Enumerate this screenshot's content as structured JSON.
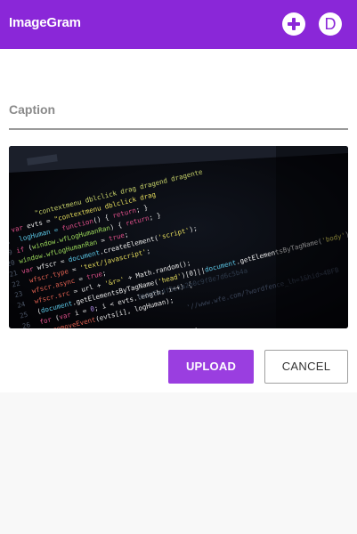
{
  "app": {
    "title": "ImageGram",
    "avatar_letter": "D",
    "brand_color": "#8a27d8"
  },
  "header": {
    "add_icon": "plus-circle-icon"
  },
  "form": {
    "caption_placeholder": "Caption",
    "caption_value": "",
    "preview_image": "code-editor-photo",
    "upload_label": "UPLOAD",
    "cancel_label": "CANCEL",
    "upload_color": "#9a3ee0"
  }
}
